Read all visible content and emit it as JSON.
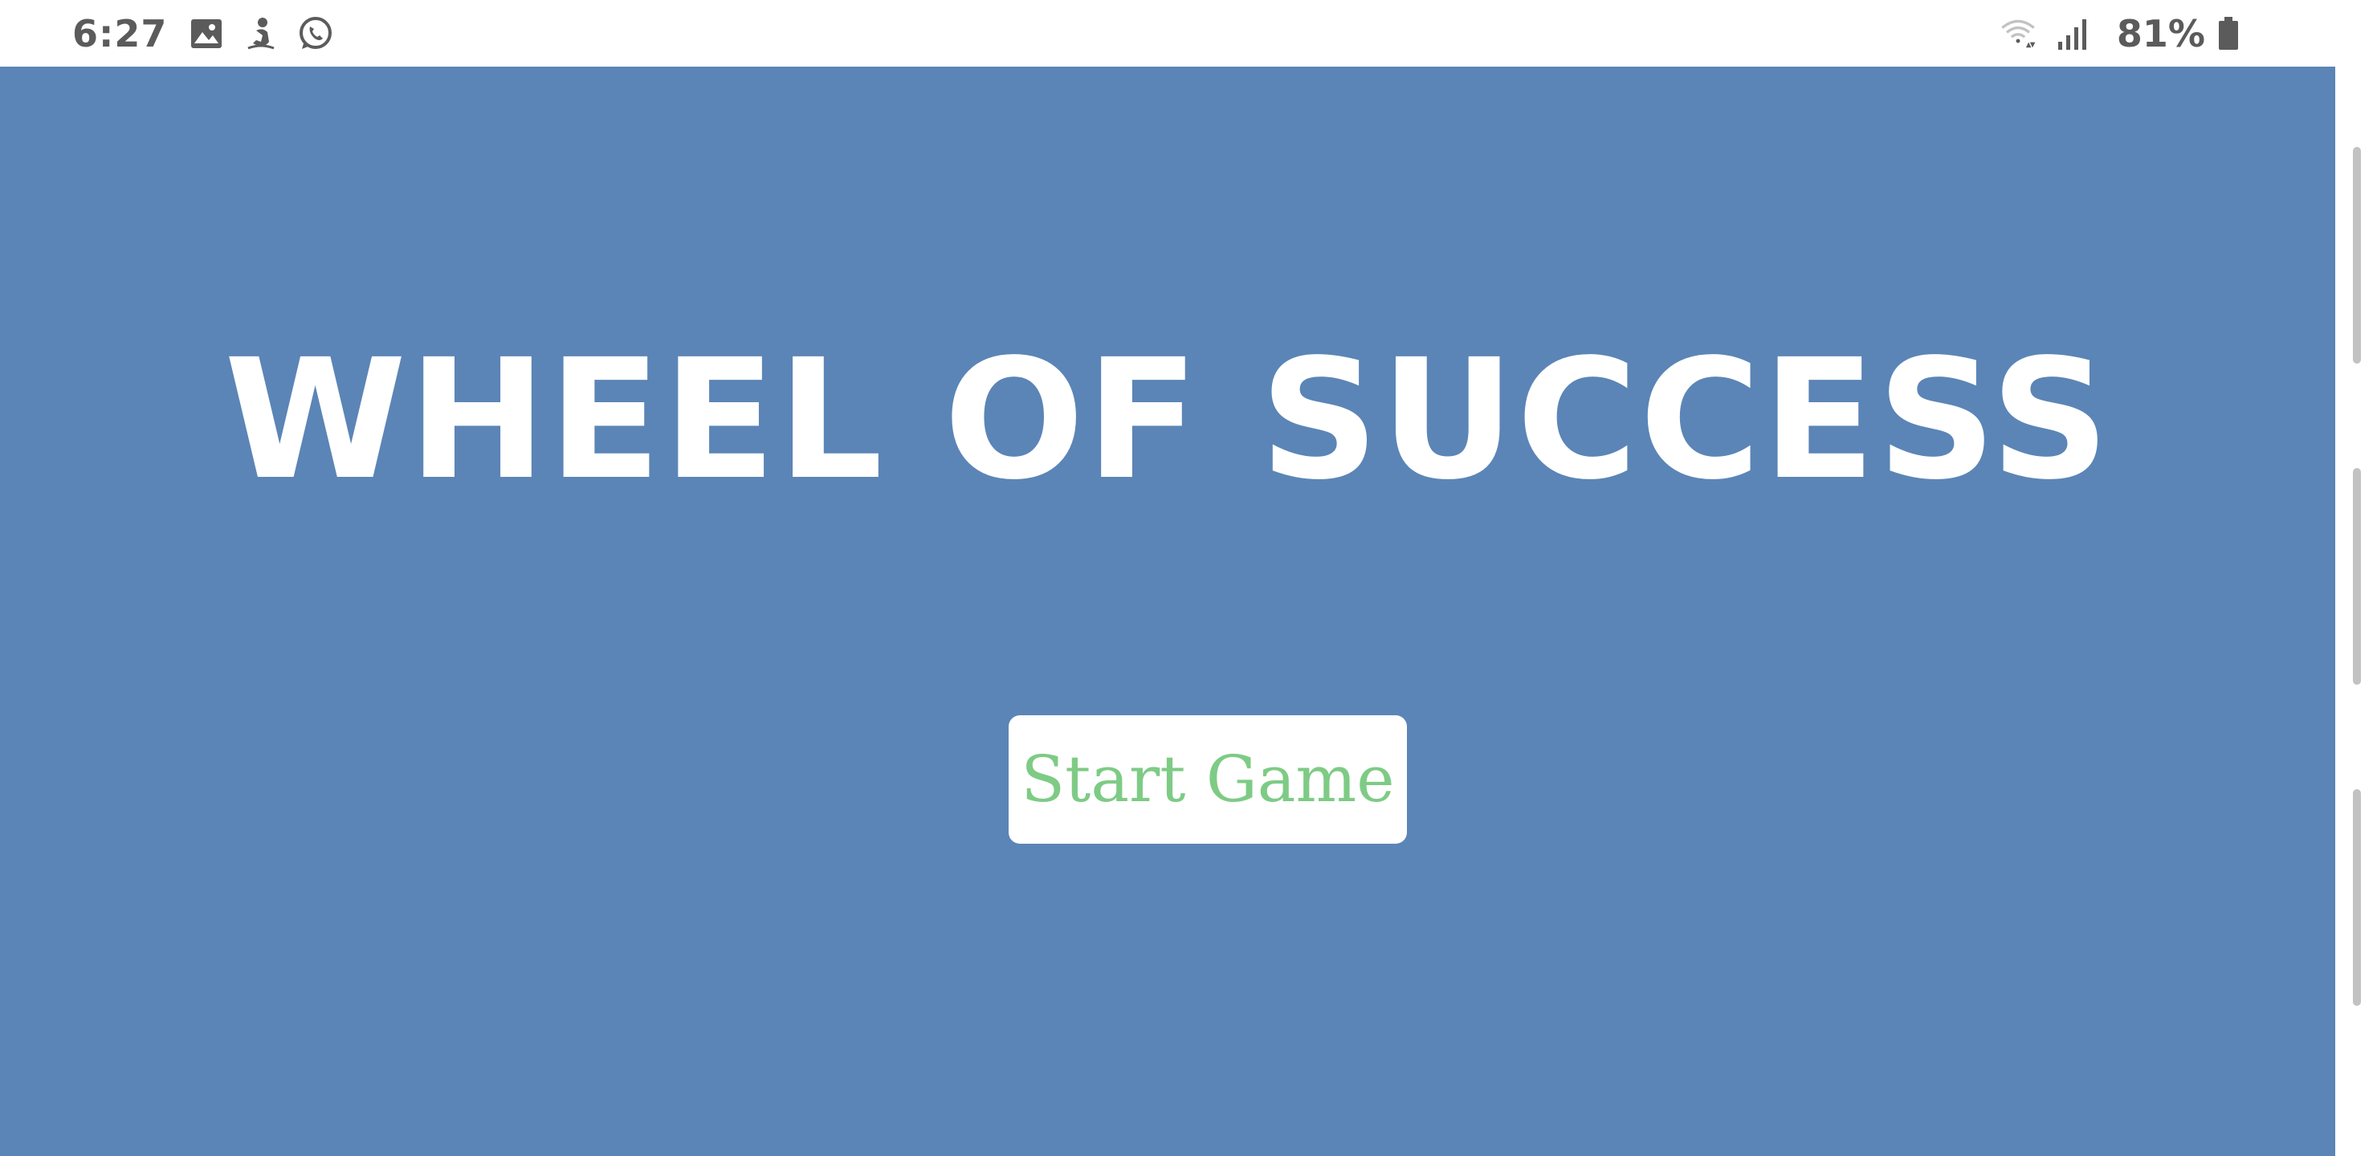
{
  "status_bar": {
    "time": "6:27",
    "battery_percent": "81%",
    "left_icons": [
      "gallery-icon",
      "notification-figure-icon",
      "whatsapp-icon"
    ],
    "right_icons": [
      "wifi-icon",
      "signal-icon",
      "battery-icon"
    ]
  },
  "app": {
    "background_color": "#5b85b6",
    "title": "WHEEL OF SUCCESS",
    "start_button_label": "Start Game",
    "start_button_text_color": "#7ecb85"
  }
}
